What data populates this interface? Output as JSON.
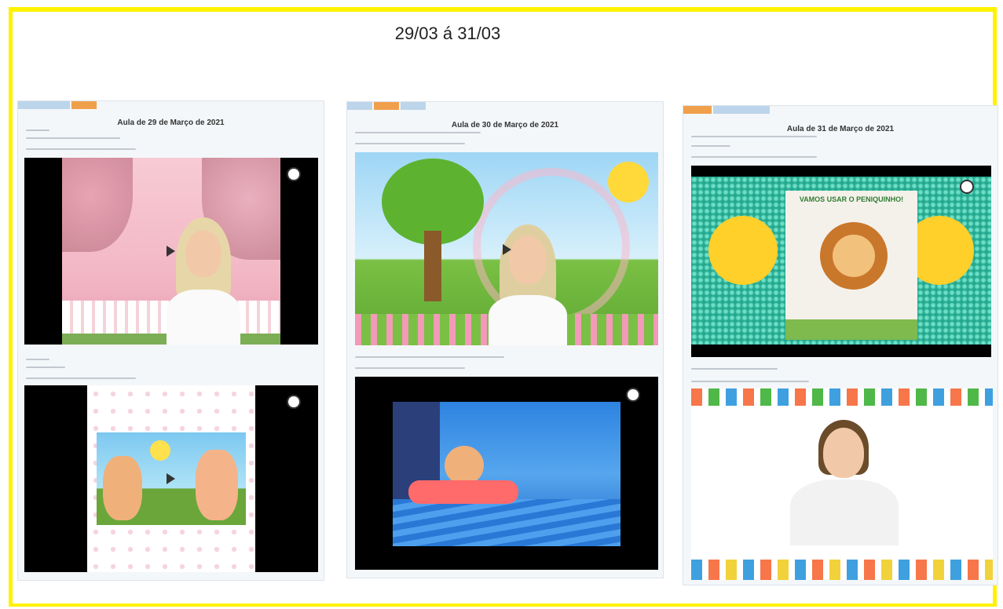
{
  "heading": "29/03 á 31/03",
  "panels": [
    {
      "title": "Aula de 29 de Março de 2021",
      "tabs": [
        "",
        ""
      ],
      "video1": {
        "logo": "camera-logo-icon",
        "play": "play-icon"
      },
      "video2": {
        "logo": "camera-logo-icon"
      }
    },
    {
      "title": "Aula de 30 de Março de 2021",
      "tabs": [
        "",
        "",
        ""
      ],
      "video1": {
        "play": "play-icon"
      },
      "video2": {
        "logo": "camera-logo-icon"
      }
    },
    {
      "title": "Aula de 31 de Março de 2021",
      "tabs": [
        "",
        ""
      ],
      "video1": {
        "sign_text": "VAMOS USAR O PENIQUINHO!",
        "logo": "camera-logo-icon"
      },
      "video2": {}
    }
  ],
  "colors": {
    "frame": "#fff200",
    "tab": "#bcd5ea",
    "tab_active": "#f0a04b"
  }
}
